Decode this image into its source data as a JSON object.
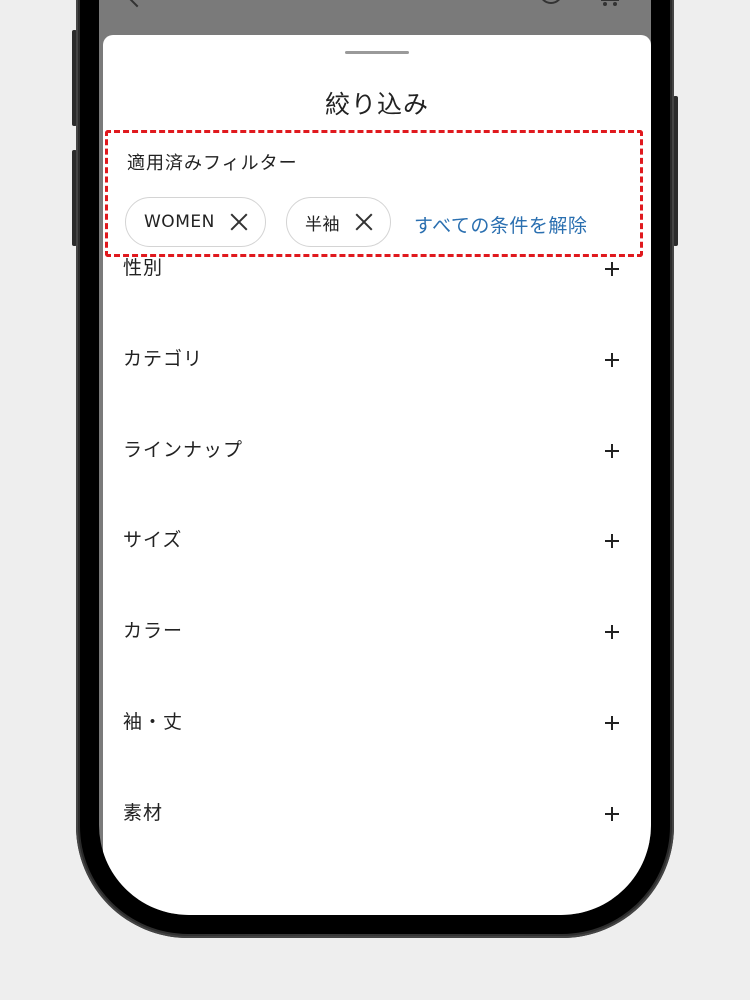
{
  "sheet": {
    "title": "絞り込み"
  },
  "applied_filters": {
    "heading": "適用済みフィルター",
    "chips": [
      {
        "label": "WOMEN"
      },
      {
        "label": "半袖"
      }
    ],
    "clear_all_label": "すべての条件を解除"
  },
  "facets": [
    {
      "label": "性別"
    },
    {
      "label": "カテゴリ"
    },
    {
      "label": "ラインナップ"
    },
    {
      "label": "サイズ"
    },
    {
      "label": "カラー"
    },
    {
      "label": "袖・丈"
    },
    {
      "label": "素材"
    }
  ],
  "icons": {
    "back": "chevron-left-icon",
    "search": "search-icon",
    "cart": "cart-icon",
    "remove": "close-icon",
    "expand": "plus-icon"
  },
  "colors": {
    "highlight_border": "#e0191e",
    "link": "#2a6fb0",
    "overlay": "#7a7a7a"
  }
}
